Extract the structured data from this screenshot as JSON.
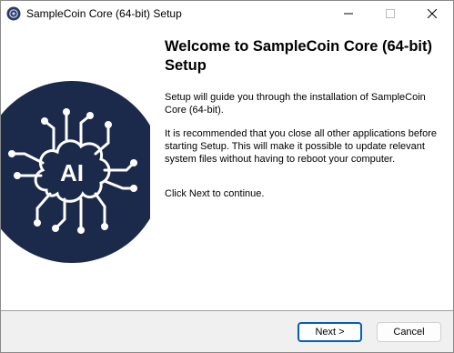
{
  "window": {
    "title": "SampleCoin Core (64-bit) Setup"
  },
  "icons": {
    "app": "app-icon",
    "minimize": "minimize-icon",
    "maximize": "maximize-icon",
    "close": "close-icon",
    "banner": "ai-brain-icon"
  },
  "banner": {
    "label": "AI",
    "circle_color": "#1b2a4a"
  },
  "main": {
    "heading": "Welcome to SampleCoin Core (64-bit) Setup",
    "paragraph1": "Setup will guide you through the installation of SampleCoin Core (64-bit).",
    "paragraph2": "It is recommended that you close all other applications before starting Setup. This will make it possible to update relevant system files without having to reboot your computer.",
    "paragraph3": "Click Next to continue."
  },
  "buttons": {
    "next": "Next >",
    "cancel": "Cancel"
  },
  "colors": {
    "accent": "#005fb8"
  }
}
